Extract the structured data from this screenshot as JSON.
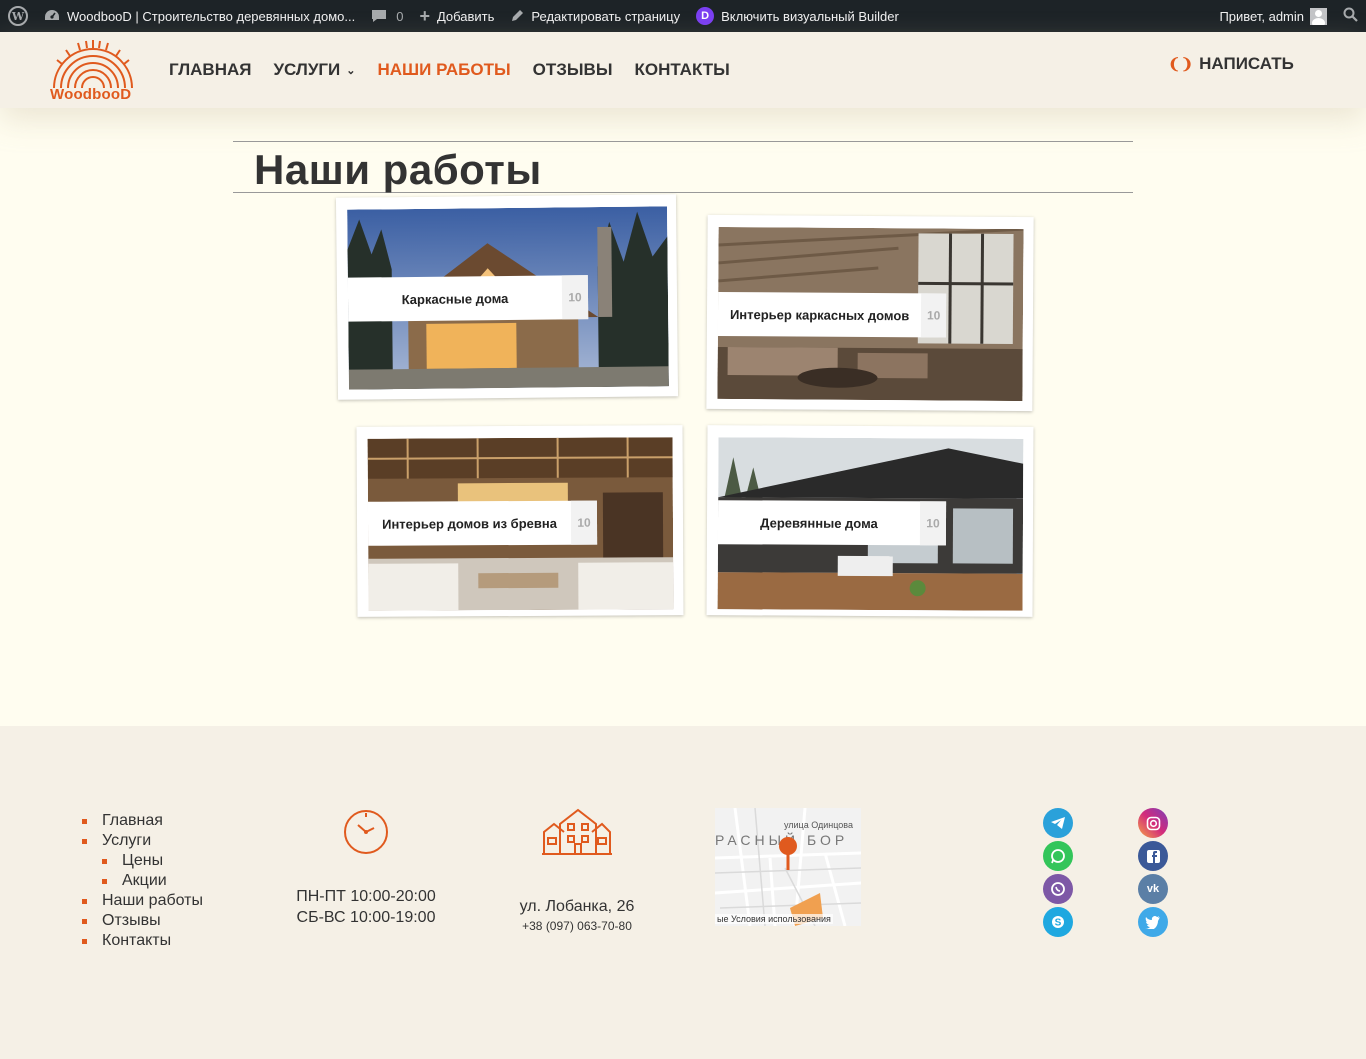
{
  "adminbar": {
    "site_name": "WoodbooD | Строительство деревянных домо...",
    "comments_count": "0",
    "add_label": "Добавить",
    "edit_label": "Редактировать страницу",
    "builder_label": "Включить визуальный Builder",
    "greeting": "Привет, admin"
  },
  "header": {
    "logo_text": "WoodbooD",
    "nav": [
      {
        "label": "ГЛАВНАЯ"
      },
      {
        "label": "УСЛУГИ"
      },
      {
        "label": "НАШИ РАБОТЫ"
      },
      {
        "label": "ОТЗЫВЫ"
      },
      {
        "label": "КОНТАКТЫ"
      }
    ],
    "write_label": "НАПИСАТЬ"
  },
  "main": {
    "title": "Наши работы",
    "galleries": [
      {
        "label": "Каркасные дома",
        "count": "10"
      },
      {
        "label": "Интерьер каркасных домов",
        "count": "10"
      },
      {
        "label": "Интерьер домов из бревна",
        "count": "10"
      },
      {
        "label": "Деревянные дома",
        "count": "10"
      }
    ]
  },
  "footer": {
    "menu": [
      {
        "label": "Главная"
      },
      {
        "label": "Услуги"
      },
      {
        "label": "Цены"
      },
      {
        "label": "Акции"
      },
      {
        "label": "Наши работы"
      },
      {
        "label": "Отзывы"
      },
      {
        "label": "Контакты"
      }
    ],
    "hours": [
      "ПН-ПТ 10:00-20:00",
      "СБ-ВС 10:00-19:00"
    ],
    "address": "ул. Лобанка, 26",
    "phone": "+38 (097) 063-70-80",
    "map": {
      "street": "улица Одинцова",
      "district": "РАСНЫЙ БОР",
      "terms": "ые   Условия использования"
    },
    "socials_left": [
      "telegram-icon",
      "whatsapp-icon",
      "viber-icon",
      "skype-icon"
    ],
    "socials_right": [
      "instagram-icon",
      "facebook-icon",
      "vk-icon",
      "twitter-icon"
    ]
  },
  "colors": {
    "accent": "#e05a1e",
    "adminbar": "#1d2327",
    "page_bg": "#fffdf0",
    "header_bg": "#f5f0e6"
  }
}
